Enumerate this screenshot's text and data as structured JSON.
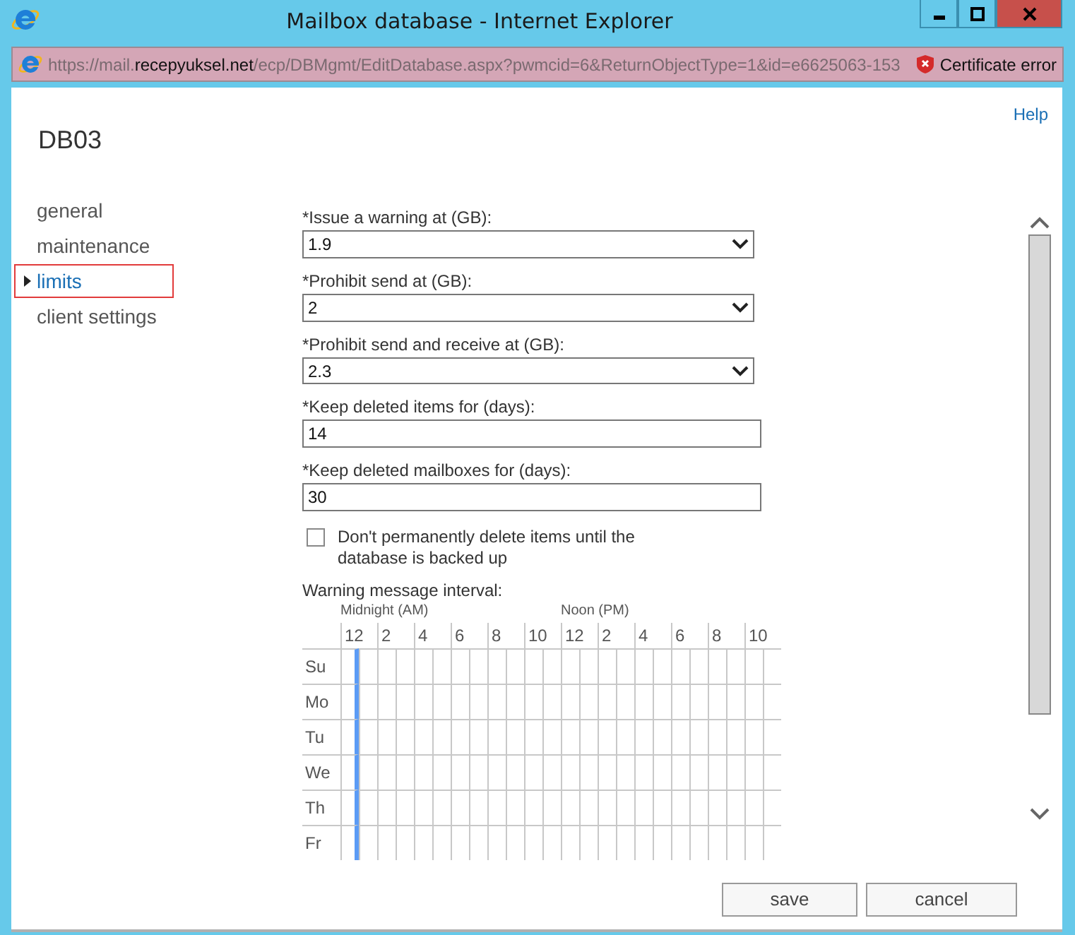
{
  "window": {
    "title": "Mailbox database - Internet Explorer"
  },
  "address_bar": {
    "url": "https://mail.**recepyuksel.net**/ecp/DBMgmt/EditDatabase.aspx?pwmcid=6&ReturnObjectType=1&id=e6625063-153",
    "certificate": "Certificate error"
  },
  "help": "Help",
  "heading": "DB03",
  "nav": [
    {
      "label": "general",
      "selected": false
    },
    {
      "label": "maintenance",
      "selected": false
    },
    {
      "label": "limits",
      "selected": true
    },
    {
      "label": "client settings",
      "selected": false
    }
  ],
  "fields": [
    {
      "kind": "select",
      "label": "*Issue a warning at (GB):",
      "value": "1.9"
    },
    {
      "kind": "select",
      "label": "*Prohibit send at (GB):",
      "value": "2"
    },
    {
      "kind": "select",
      "label": "*Prohibit send and receive at (GB):",
      "value": "2.3"
    },
    {
      "kind": "text",
      "label": "*Keep deleted items for (days):",
      "value": "14"
    },
    {
      "kind": "text",
      "label": "*Keep deleted mailboxes for (days):",
      "value": "30"
    }
  ],
  "checkbox": {
    "label": "Don't permanently delete items until the database is backed up",
    "checked": false
  },
  "schedule": {
    "label": "Warning message interval:",
    "am": "Midnight (AM)",
    "pm": "Noon (PM)",
    "hour_labels": [
      "12",
      "2",
      "4",
      "6",
      "8",
      "10",
      "12",
      "2",
      "4",
      "6",
      "8",
      "10"
    ],
    "hours": [
      {
        "selected": true
      },
      {
        "selected": false
      },
      {
        "selected": false
      },
      {
        "selected": false
      },
      {
        "selected": false
      },
      {
        "selected": false
      },
      {
        "selected": false
      },
      {
        "selected": false
      },
      {
        "selected": false
      },
      {
        "selected": false
      },
      {
        "selected": false
      },
      {
        "selected": false
      },
      {
        "selected": false
      },
      {
        "selected": false
      },
      {
        "selected": false
      },
      {
        "selected": false
      },
      {
        "selected": false
      },
      {
        "selected": false
      },
      {
        "selected": false
      },
      {
        "selected": false
      },
      {
        "selected": false
      },
      {
        "selected": false
      },
      {
        "selected": false
      },
      {
        "selected": false
      }
    ],
    "days": [
      "Su",
      "Mo",
      "Tu",
      "We",
      "Th",
      "Fr"
    ]
  },
  "buttons": [
    "save",
    "cancel"
  ]
}
